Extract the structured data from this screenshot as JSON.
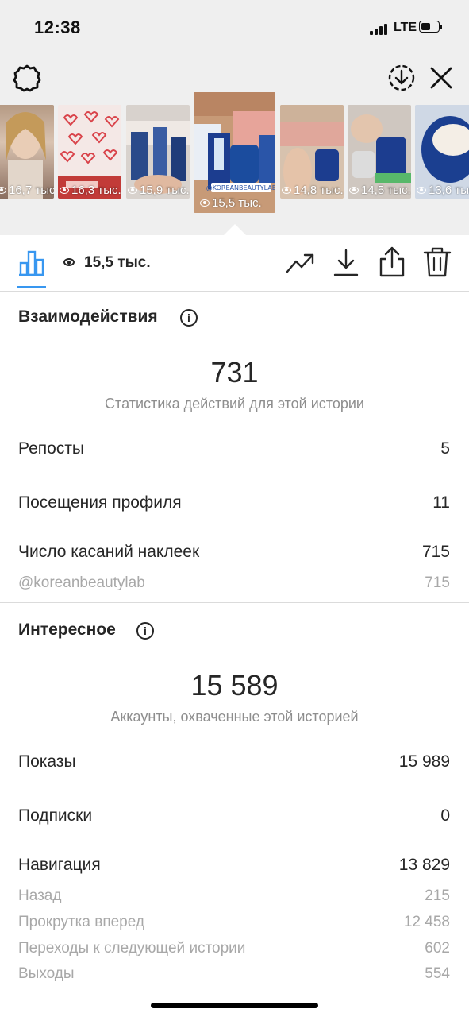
{
  "status_bar": {
    "time": "12:38",
    "network": "LTE"
  },
  "stories": [
    {
      "views": "16,7 тыс.",
      "colors": [
        "#cdb7a6",
        "#e8d4c4",
        "#8a6a5a"
      ]
    },
    {
      "views": "16,3 тыс.",
      "colors": [
        "#f3e5e3",
        "#d9434a",
        "#ffffff"
      ]
    },
    {
      "views": "15,9 тыс.",
      "colors": [
        "#c9c3c0",
        "#2a4a8a",
        "#e9e3de"
      ]
    },
    {
      "views": "15,5 тыс.",
      "sticker": "@KOREANBEAUTYLAB",
      "selected": true,
      "colors": [
        "#c79a77",
        "#e7a49a",
        "#1c3d8f"
      ]
    },
    {
      "views": "14,8 тыс.",
      "colors": [
        "#d7c2ae",
        "#e0a79b",
        "#1c3d8f"
      ]
    },
    {
      "views": "14,5 тыс.",
      "colors": [
        "#cfc7c0",
        "#1c3d8f",
        "#e5e5e5"
      ]
    },
    {
      "views": "13,6 тыс.",
      "colors": [
        "#cfd8e5",
        "#1b3f90",
        "#f2ece4"
      ]
    }
  ],
  "toolbar": {
    "reach": "15,5 тыс."
  },
  "interactions": {
    "title": "Взаимодействия",
    "total": "731",
    "caption": "Статистика действий для этой истории",
    "rows": [
      {
        "label": "Репосты",
        "value": "5"
      },
      {
        "label": "Посещения профиля",
        "value": "11"
      },
      {
        "label": "Число касаний наклеек",
        "value": "715"
      }
    ],
    "sticker_row": {
      "label": "@koreanbeautylab",
      "value": "715"
    }
  },
  "discovery": {
    "title": "Интересное",
    "total": "15 589",
    "caption": "Аккаунты, охваченные этой историей",
    "rows": [
      {
        "label": "Показы",
        "value": "15 989"
      },
      {
        "label": "Подписки",
        "value": "0"
      },
      {
        "label": "Навигация",
        "value": "13 829"
      }
    ],
    "navigation": [
      {
        "label": "Назад",
        "value": "215"
      },
      {
        "label": "Прокрутка вперед",
        "value": "12 458"
      },
      {
        "label": "Переходы к следующей истории",
        "value": "602"
      },
      {
        "label": "Выходы",
        "value": "554"
      }
    ]
  },
  "colors": {
    "accent": "#3897f0",
    "text": "#262626",
    "muted": "#8e8e8e"
  }
}
